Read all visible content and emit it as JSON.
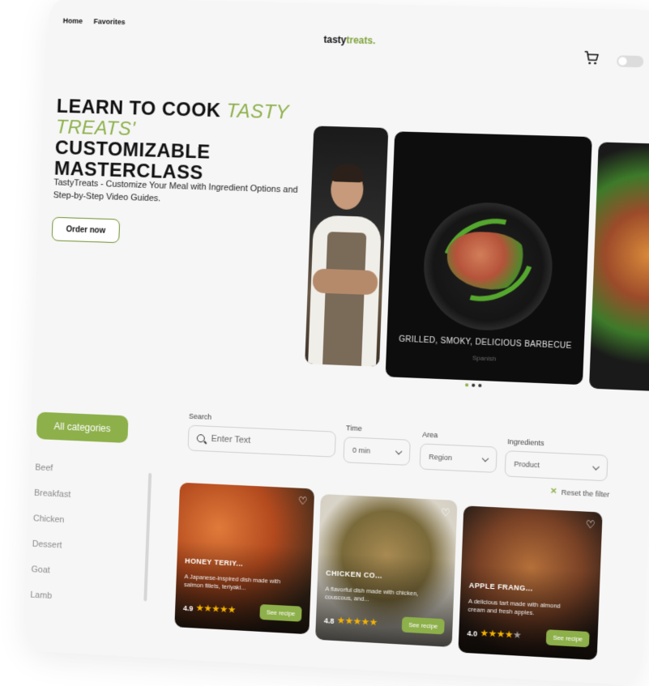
{
  "nav": {
    "home": "Home",
    "favorites": "Favorites"
  },
  "logo": {
    "main": "tasty",
    "accent": "treats."
  },
  "hero": {
    "title_part1": "Learn to cook ",
    "title_accent": "Tasty Treats'",
    "title_part2": " customizable masterclass",
    "subtitle": "TastyTreats - Customize Your Meal with Ingredient Options and Step-by-Step Video Guides.",
    "order_button": "Order now"
  },
  "slider": {
    "caption": "GRILLED, SMOKY, DELICIOUS BARBECUE",
    "sub": "Spanish",
    "dots": 3,
    "active_dot": 0
  },
  "sidebar": {
    "all_categories": "All categories",
    "categories": [
      "Beef",
      "Breakfast",
      "Chicken",
      "Dessert",
      "Goat",
      "Lamb"
    ]
  },
  "filters": {
    "search_label": "Search",
    "search_placeholder": "Enter Text",
    "time_label": "Time",
    "time_value": "0 min",
    "area_label": "Area",
    "area_value": "Region",
    "ingredients_label": "Ingredients",
    "ingredients_value": "Product",
    "reset": "Reset the filter"
  },
  "cards": [
    {
      "title": "HONEY TERIY...",
      "desc": "A Japanese-inspired dish made with salmon fillets, teriyaki...",
      "rating": "4.9",
      "stars": 5,
      "button": "See recipe"
    },
    {
      "title": "CHICKEN CO...",
      "desc": "A flavorful dish made with chicken, couscous, and...",
      "rating": "4.8",
      "stars": 5,
      "button": "See recipe"
    },
    {
      "title": "APPLE FRANG...",
      "desc": "A delicious tart made with almond cream and fresh apples.",
      "rating": "4.0",
      "stars": 4,
      "button": "See recipe"
    }
  ],
  "colors": {
    "accent": "#8db04a",
    "background": "#f6f6f6"
  }
}
